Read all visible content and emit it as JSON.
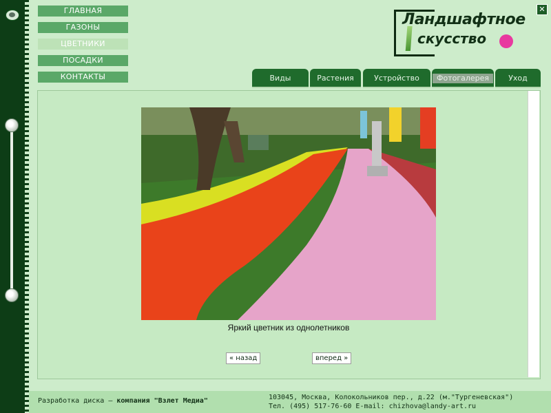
{
  "window": {
    "close_label": "✕"
  },
  "menu": {
    "items": [
      {
        "label": "ГЛАВНАЯ",
        "active": false
      },
      {
        "label": "ГАЗОНЫ",
        "active": false
      },
      {
        "label": "ЦВЕТНИКИ",
        "active": true
      },
      {
        "label": "ПОСАДКИ",
        "active": false
      },
      {
        "label": "КОНТАКТЫ",
        "active": false
      }
    ]
  },
  "logo": {
    "line1": "Ландшафтное",
    "line2": "скусство"
  },
  "tabs": [
    {
      "label": "Виды"
    },
    {
      "label": "Растения"
    },
    {
      "label": "Устройство"
    },
    {
      "label": "Фотогалерея",
      "active": true
    },
    {
      "label": "Уход"
    }
  ],
  "gallery": {
    "caption": "Яркий цветник из однолетников",
    "prev_label": "« назад",
    "next_label": "вперед »"
  },
  "footer": {
    "credit_prefix": "Разработка диска — ",
    "credit_company": "компания \"Взлет Медиа\"",
    "address": "103045, Москва, Колокольников пер., д.22 (м.\"Тургеневская\")",
    "contacts": "Тел. (495) 517-76-60 E-mail: chizhova@landy-art.ru"
  },
  "colors": {
    "accent": "#1f6b2c",
    "menu": "#5aa868",
    "logo_dot": "#e8399f"
  }
}
